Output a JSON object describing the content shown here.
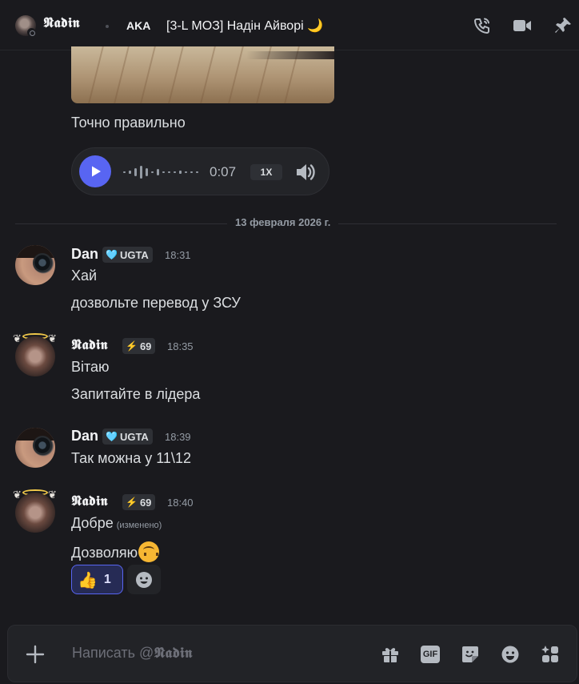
{
  "header": {
    "name": "𝕹𝖆𝖉𝖎𝖓",
    "tag": "AKA",
    "clan": "[3-L МОЗ] Надін Айворі 🌙",
    "icons": [
      "voice-call-icon",
      "video-call-icon",
      "pin-icon"
    ]
  },
  "top_message": {
    "text": "Точно правильно",
    "voice": {
      "time": "0:07",
      "speed": "1X"
    }
  },
  "divider": {
    "date": "13 февраля 2026 г."
  },
  "messages": [
    {
      "author": "Dan",
      "badge": "UGTA",
      "badge_icon": "🩵",
      "time": "18:31",
      "lines": [
        "Хай",
        "дозвольте перевод у ЗСУ"
      ]
    },
    {
      "author": "𝕹𝖆𝖉𝖎𝖓",
      "badge": "69",
      "badge_icon": "⚡",
      "time": "18:35",
      "lines": [
        "Вітаю",
        "Запитайте в лідера"
      ]
    },
    {
      "author": "Dan",
      "badge": "UGTA",
      "badge_icon": "🩵",
      "time": "18:39",
      "lines": [
        "Так можна у 11\\12"
      ]
    },
    {
      "author": "𝕹𝖆𝖉𝖎𝖓",
      "badge": "69",
      "badge_icon": "⚡",
      "time": "18:40",
      "lines": [
        "Добре",
        "Дозволяю"
      ],
      "edited": "(изменено)"
    }
  ],
  "reaction": {
    "emoji": "👍",
    "count": "1"
  },
  "composer": {
    "placeholder_prefix": "Написать @",
    "placeholder_name": "𝕹𝖆𝖉𝖎𝖓",
    "gif_label": "GIF"
  },
  "colors": {
    "accent": "#5865f2",
    "background": "#1a1a1e",
    "text": "#dbdee1",
    "muted": "#949ba4"
  }
}
